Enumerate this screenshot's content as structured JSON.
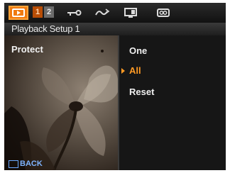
{
  "header": {
    "tabs": [
      {
        "name": "playback-icon",
        "active": true
      },
      {
        "name": "setup-1-tab",
        "label": "1",
        "active": false
      },
      {
        "name": "setup-2-tab",
        "label": "2",
        "active": false
      },
      {
        "name": "key-icon",
        "active": false
      },
      {
        "name": "wave-icon",
        "active": false
      },
      {
        "name": "monitor-icon",
        "active": false
      },
      {
        "name": "card-icon",
        "active": false
      }
    ],
    "title": "Playback Setup 1"
  },
  "left_panel": {
    "label": "Protect"
  },
  "menu": {
    "items": [
      {
        "label": "One",
        "selected": false
      },
      {
        "label": "All",
        "selected": true
      },
      {
        "label": "Reset",
        "selected": false
      }
    ]
  },
  "footer": {
    "back_key": "",
    "back_label": "BACK"
  },
  "colors": {
    "accent": "#f07a10",
    "selected_text": "#ff9a24",
    "back_text": "#7fb4ff"
  }
}
